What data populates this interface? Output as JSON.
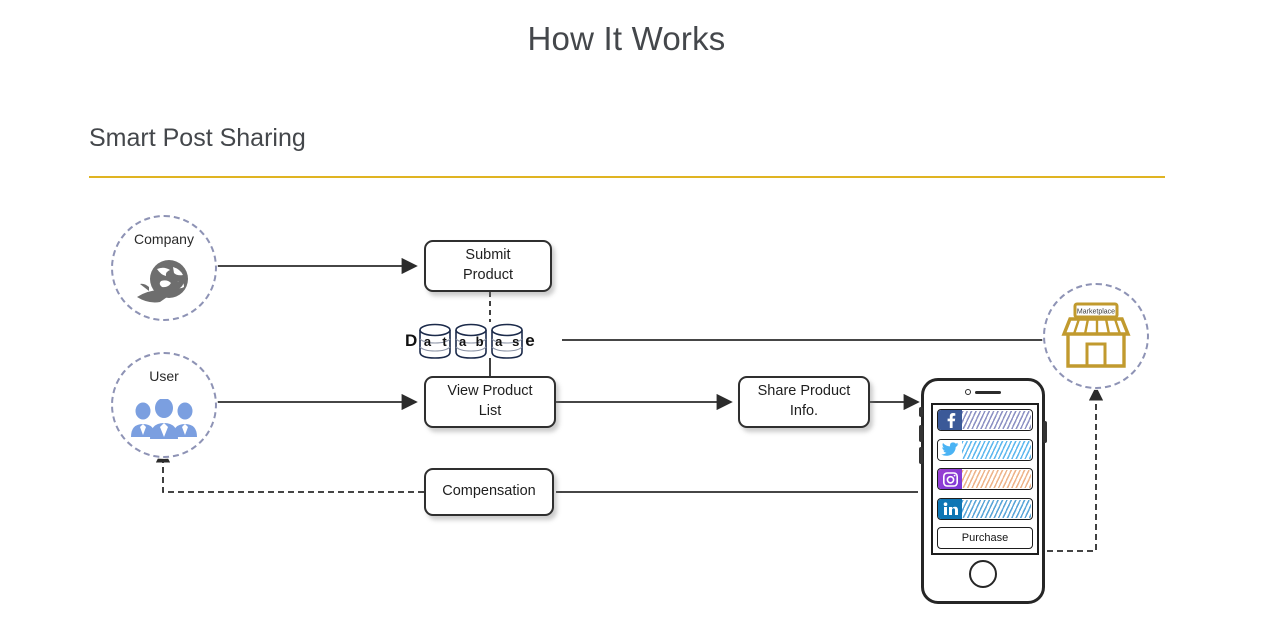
{
  "header": {
    "title": "How It Works",
    "section_title": "Smart Post Sharing",
    "rule_color": "#e0b422"
  },
  "diagram": {
    "nodes": [
      {
        "id": "company",
        "label": "Company",
        "icon": "globe-airplane-icon",
        "icon_color": "#6e6e6e",
        "border_color": "#8e93b5"
      },
      {
        "id": "user",
        "label": "User",
        "icon": "people-group-icon",
        "icon_color": "#7b9fe0",
        "border_color": "#8e93b5"
      },
      {
        "id": "marketplace",
        "label": "Marketplace",
        "icon": "storefront-icon",
        "icon_color": "#c19a2e",
        "border_color": "#8e93b5"
      }
    ],
    "boxes": [
      {
        "id": "submit",
        "line1": "Submit",
        "line2": "Product"
      },
      {
        "id": "view",
        "line1": "View Product",
        "line2": "List"
      },
      {
        "id": "share",
        "line1": "Share Product",
        "line2": "Info."
      },
      {
        "id": "compensation",
        "line1": "Compensation",
        "line2": ""
      }
    ],
    "database": {
      "prefix": "D",
      "suffix": "e",
      "cylinders": [
        {
          "left": "a",
          "right": "t"
        },
        {
          "left": "a",
          "right": "b"
        },
        {
          "left": "a",
          "right": "s"
        }
      ]
    },
    "phone": {
      "social_rows": [
        {
          "network": "facebook",
          "icon": "facebook-icon",
          "icon_bg": "#3b5998",
          "bar_color": "#8d92c4"
        },
        {
          "network": "twitter",
          "icon": "twitter-icon",
          "icon_bg": "#ffffff",
          "bar_color": "#5fb8ef"
        },
        {
          "network": "instagram",
          "icon": "instagram-icon",
          "icon_bg": "#8a3ab9",
          "bar_color": "#efb48a"
        },
        {
          "network": "linkedin",
          "icon": "linkedin-icon",
          "icon_bg": "#0f76b4",
          "bar_color": "#5aa6d8"
        }
      ],
      "purchase_label": "Purchase"
    }
  }
}
